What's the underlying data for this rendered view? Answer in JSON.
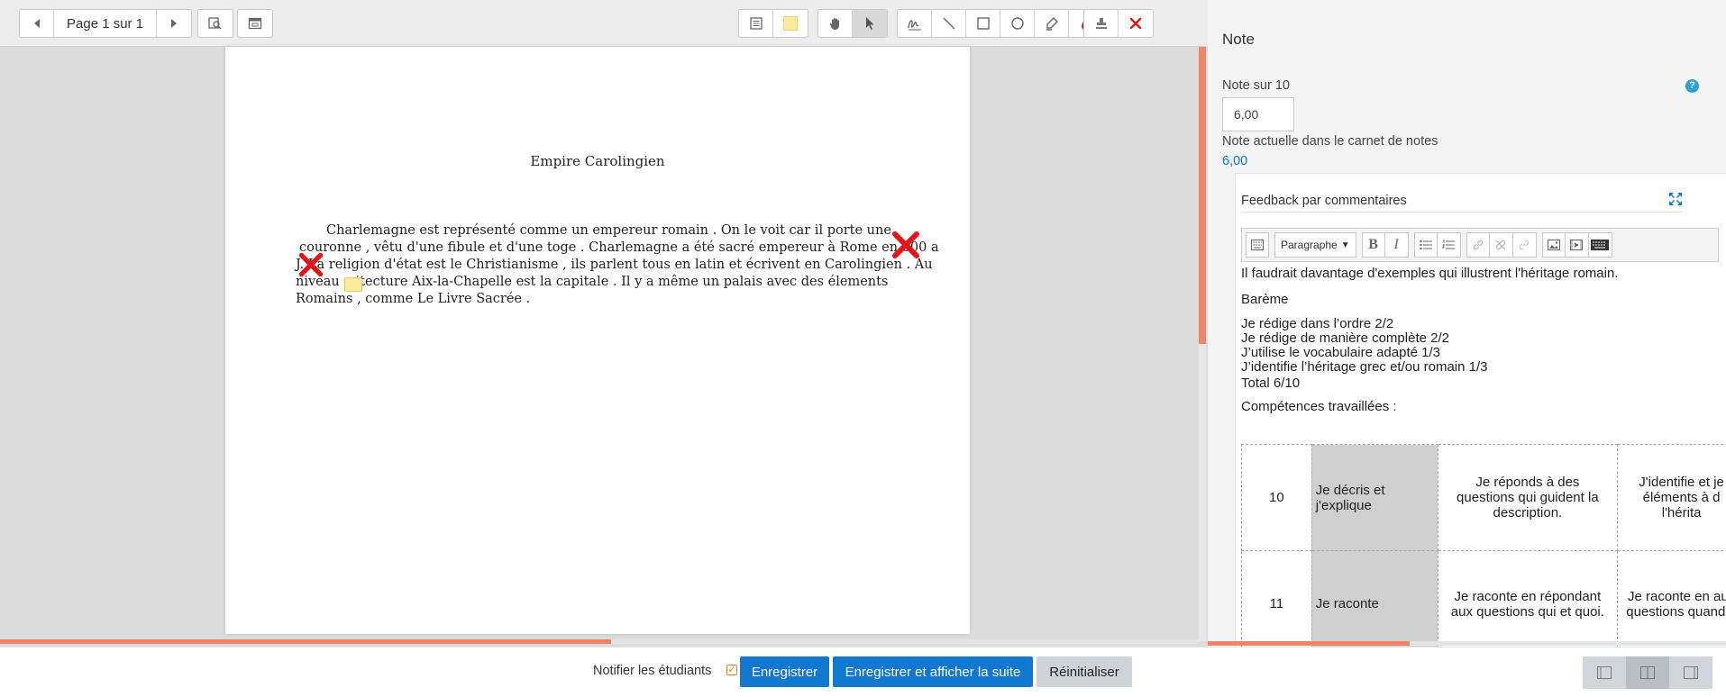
{
  "viewer": {
    "page_label": "Page 1 sur 1",
    "toolbar_icons": [
      "prev-page-icon",
      "next-page-icon",
      "search-comments-icon",
      "expand-comments-icon",
      "comment-tool-icon",
      "comment-color-icon",
      "pan-tool-icon",
      "select-tool-icon",
      "pen-tool-icon",
      "line-tool-icon",
      "rectangle-tool-icon",
      "oval-tool-icon",
      "highlight-tool-icon",
      "annotation-color-icon",
      "stamp-tool-icon",
      "stamp-image-icon"
    ],
    "colors": {
      "comment_color": "#ffe99e",
      "annotation_color": "#e3141a",
      "stamp_color": "#e3141a"
    },
    "progress_fraction": 0.51
  },
  "document": {
    "title": "Empire Carolingien",
    "lines": [
      "Charlemagne est représenté comme un empereur romain . On le voit car il porte une",
      "couronne , vêtu d'une fibule et d'une toge . Charlemagne a été sacré empereur à Rome          en 800 a",
      "J.    La religion d'état est le Christianisme , ils parlent tous en latin et écrivent          en Carolingien . Au",
      "niveau a    itecture Aix-la-Chapelle est la capitale . Il y a même un           palais avec des élements",
      "Romains , comme Le Livre Sacrée ."
    ]
  },
  "panel": {
    "heading": "Note",
    "grade_label": "Note sur 10",
    "grade_value": "6,00",
    "current_grade_label": "Note actuelle dans le carnet de notes",
    "current_grade_value": "6,00",
    "feedback_label": "Feedback par commentaires",
    "editor": {
      "format_select": "Paragraphe",
      "bold": "B",
      "italic": "I",
      "lines": [
        "Il faudrait davantage d'exemples qui illustrent l'héritage romain.",
        "Barème",
        "Je rédige dans l’ordre 2/2",
        "Je rédige de manière complète 2/2",
        "J’utilise le vocabulaire adapté 1/3",
        "J’identifie l’héritage grec et/ou romain 1/3",
        "Total 6/10",
        "Compétences travaillées :"
      ],
      "table": [
        {
          "num": "10",
          "skill": "Je décris et j'explique",
          "desc": "Je réponds à des questions qui guident la description.",
          "desc2": "J'identifie et je éléments à d l'hérita"
        },
        {
          "num": "11",
          "skill": "Je raconte",
          "desc": "Je raconte en répondant aux questions qui et quoi.",
          "desc2": "Je raconte en aux questions quand e"
        }
      ]
    },
    "scroll_fraction": 0.39
  },
  "footer": {
    "notify_label": "Notifier les étudiants",
    "notify_checked": true,
    "save": "Enregistrer",
    "save_next": "Enregistrer et afficher la suite",
    "reset": "Réinitialiser",
    "layout_active": 1
  }
}
